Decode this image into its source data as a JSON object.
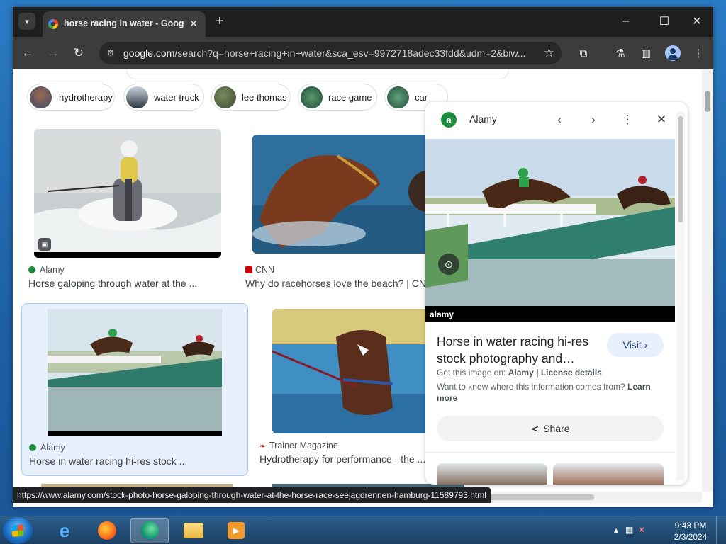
{
  "browser": {
    "tab_title": "horse racing in water - Google",
    "url_host": "google.com",
    "url_rest": "/search?q=horse+racing+in+water&sca_esv=9972718adec33fdd&udm=2&biw...",
    "status_url": "https://www.alamy.com/stock-photo-horse-galoping-through-water-at-the-horse-race-seejagdrennen-hamburg-11589793.html"
  },
  "chips": [
    {
      "label": "hydrotherapy"
    },
    {
      "label": "water truck"
    },
    {
      "label": "lee thomas"
    },
    {
      "label": "race game"
    },
    {
      "label": "car"
    }
  ],
  "results": [
    {
      "source": "Alamy",
      "caption": "Horse galoping through water at the ..."
    },
    {
      "source": "CNN",
      "caption": "Why do racehorses love the beach? | CNN"
    },
    {
      "source": "Alamy",
      "caption": "Horse in water racing hi-res stock ..."
    },
    {
      "source": "Trainer Magazine",
      "caption": "Hydrotherapy for performance - the ..."
    }
  ],
  "panel": {
    "site": "Alamy",
    "logo_letter": "a",
    "title": "Horse in water racing hi-res stock photography and…",
    "visit_label": "Visit",
    "license_prefix": "Get this image on:",
    "license_site": "Alamy",
    "license_sep": "|",
    "license_details": "License details",
    "info_text": "Want to know where this information comes from?",
    "info_link": "Learn more",
    "share_label": "Share",
    "watermark": "alamy"
  },
  "taskbar": {
    "time": "9:43 PM",
    "date": "2/3/2024"
  },
  "colors": {
    "accent": "#1a73e8",
    "alamy_green": "#1e8e3e",
    "selected_bg": "#e8f0fe"
  }
}
